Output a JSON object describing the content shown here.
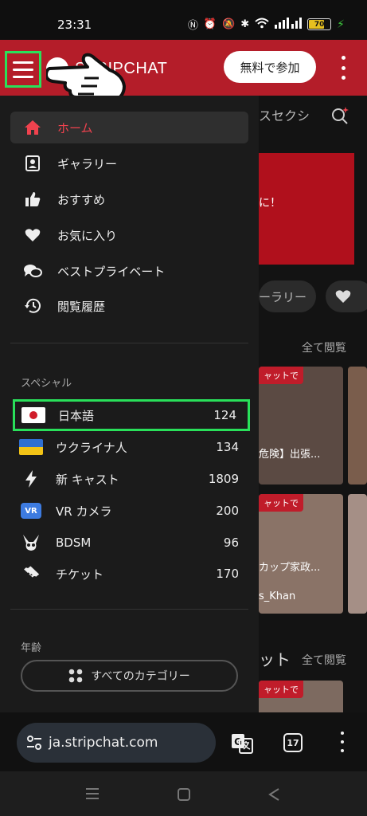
{
  "status": {
    "time": "23:31",
    "battery": "70"
  },
  "header": {
    "logo_text": "STRIPCHAT",
    "join_button": "無料で参加"
  },
  "background": {
    "tab_label": "スセクシ",
    "banner_text": "に！",
    "chip_label": "ーラリー",
    "view_all": "全て閲覧",
    "thumb1_tag": "ャットで",
    "thumb1_caption": "危険】出張...",
    "thumb2_tag": "ャットで",
    "thumb2_caption": "カップ家政...",
    "thumb2_name": "s_Khan",
    "live_label": "ット",
    "view_all_2": "全て閲覧",
    "thumb3_tag": "ャットで"
  },
  "drawer": {
    "nav_items": [
      {
        "label": "ホーム",
        "icon": "home-icon",
        "active": true
      },
      {
        "label": "ギャラリー",
        "icon": "gallery-icon",
        "active": false
      },
      {
        "label": "おすすめ",
        "icon": "thumbs-up-icon",
        "active": false
      },
      {
        "label": "お気に入り",
        "icon": "heart-icon",
        "active": false
      },
      {
        "label": "ベストプライベート",
        "icon": "chat-bubbles-icon",
        "active": false
      },
      {
        "label": "閲覧履歴",
        "icon": "history-icon",
        "active": false
      }
    ],
    "special_title": "スペシャル",
    "special_items": [
      {
        "label": "日本語",
        "count": "124",
        "icon": "japan-flag-icon"
      },
      {
        "label": "ウクライナ人",
        "count": "134",
        "icon": "ukraine-flag-icon"
      },
      {
        "label": "新 キャスト",
        "count": "1809",
        "icon": "lightning-icon"
      },
      {
        "label": "VR カメラ",
        "count": "200",
        "icon": "vr-icon",
        "badge": "VR"
      },
      {
        "label": "BDSM",
        "count": "96",
        "icon": "bunny-mask-icon"
      },
      {
        "label": "チケット",
        "count": "170",
        "icon": "ticket-icon"
      }
    ],
    "age_title": "年齢",
    "all_categories": "すべてのカテゴリー"
  },
  "browser": {
    "url": "ja.stripchat.com",
    "tab_count": "17"
  },
  "colors": {
    "brand_red": "#b41d29",
    "active_red": "#f0424e",
    "highlight_green": "#29e05a"
  }
}
